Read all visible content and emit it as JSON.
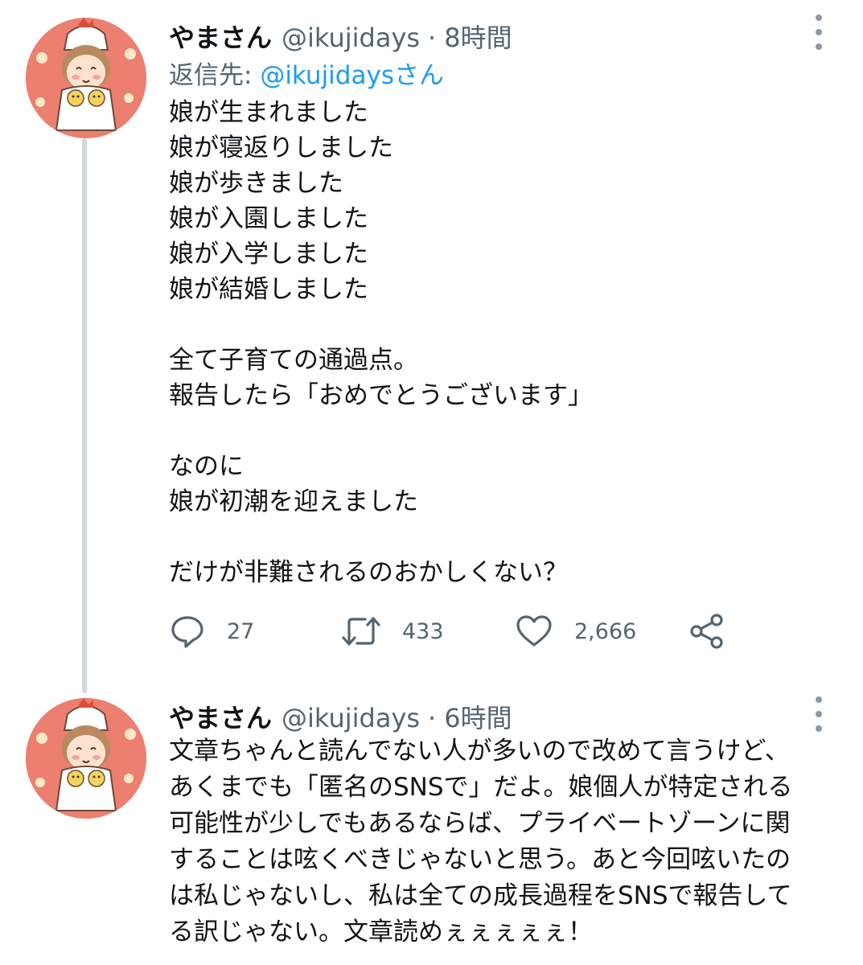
{
  "tweets": [
    {
      "display_name": "やまさん",
      "handle": "@ikujidays",
      "separator": "·",
      "time": "8時間",
      "reply_prefix": "返信先: ",
      "reply_mention": "@ikujidaysさん",
      "text": "娘が生まれました\n娘が寝返りしました\n娘が歩きました\n娘が入園しました\n娘が入学しました\n娘が結婚しました\n\n全て子育ての通過点。\n報告したら「おめでとうございます」\n\nなのに\n娘が初潮を迎えました\n\nだけが非難されるのおかしくない？",
      "actions": {
        "reply_count": "27",
        "retweet_count": "433",
        "like_count": "2,666"
      }
    },
    {
      "display_name": "やまさん",
      "handle": "@ikujidays",
      "separator": "·",
      "time": "6時間",
      "text": "文章ちゃんと読んでない人が多いので改めて言うけど、\nあくまでも「匿名のSNSで」だよ。娘個人が特定される\n可能性が少しでもあるならば、プライベートゾーンに関\nすることは呟くべきじゃないと思う。あと今回呟いたの\nは私じゃないし、私は全ての成長過程をSNSで報告して\nる訳じゃない。文章読めぇぇぇぇぇ！"
    }
  ],
  "colors": {
    "avatar_bg": "#ec7f6f",
    "mention": "#1d9bf0",
    "secondary_text": "#536471",
    "thread_line": "#cfd9de"
  },
  "icons": [
    "avatar-icon",
    "more-options-icon",
    "reply-icon",
    "retweet-icon",
    "like-icon",
    "share-icon"
  ]
}
